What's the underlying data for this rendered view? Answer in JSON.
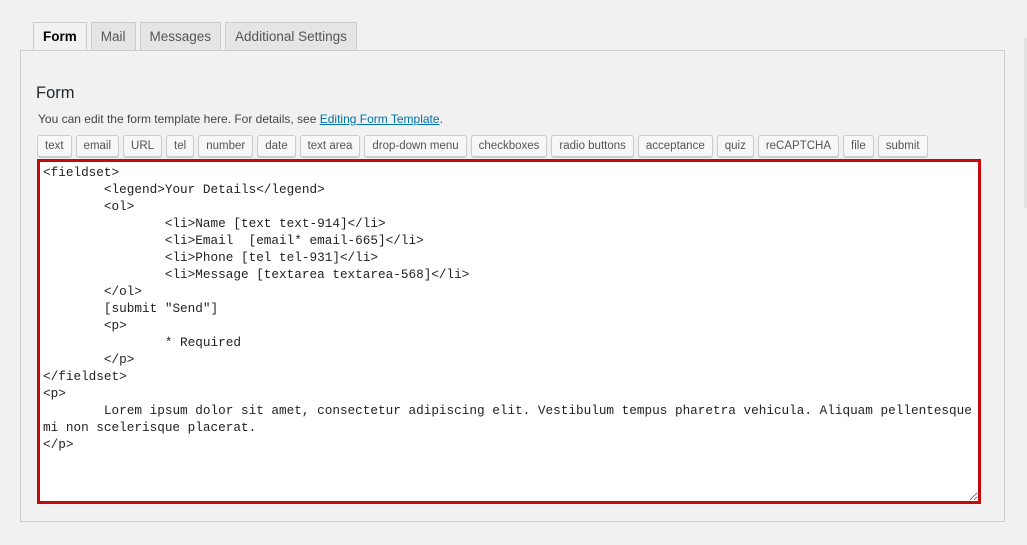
{
  "tabs": [
    {
      "label": "Form",
      "active": true
    },
    {
      "label": "Mail",
      "active": false
    },
    {
      "label": "Messages",
      "active": false
    },
    {
      "label": "Additional Settings",
      "active": false
    }
  ],
  "section": {
    "title": "Form",
    "description_prefix": "You can edit the form template here. For details, see ",
    "description_link": "Editing Form Template",
    "description_suffix": "."
  },
  "tag_buttons": [
    "text",
    "email",
    "URL",
    "tel",
    "number",
    "date",
    "text area",
    "drop-down menu",
    "checkboxes",
    "radio buttons",
    "acceptance",
    "quiz",
    "reCAPTCHA",
    "file",
    "submit"
  ],
  "editor": {
    "content": "<fieldset>\n\t<legend>Your Details</legend>\n\t<ol>\n\t\t<li>Name [text text-914]</li>\n\t\t<li>Email  [email* email-665]</li>\n\t\t<li>Phone [tel tel-931]</li>\n\t\t<li>Message [textarea textarea-568]</li>\n\t</ol>\n\t[submit \"Send\"]\n\t<p>\n\t\t* Required\n\t</p>\n</fieldset>\n<p>\n\tLorem ipsum dolor sit amet, consectetur adipiscing elit. Vestibulum tempus pharetra vehicula. Aliquam pellentesque mi non scelerisque placerat.\n</p>"
  },
  "colors": {
    "link": "#0073aa",
    "editor_border": "#c40a0a"
  }
}
